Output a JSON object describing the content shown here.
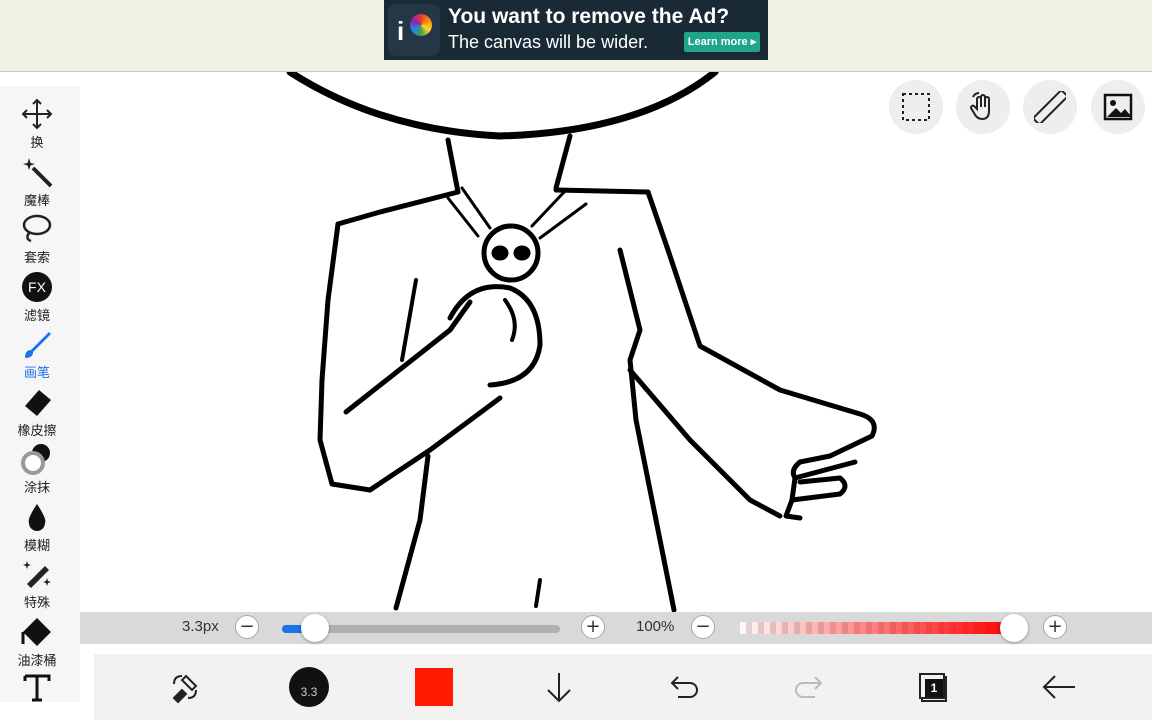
{
  "ad": {
    "title": "You want to remove the Ad?",
    "subtitle": "The canvas will be wider.",
    "cta": "Learn more ▸"
  },
  "tools": [
    {
      "name": "transform",
      "label": "换",
      "icon": "move-arrows-icon"
    },
    {
      "name": "magic-wand",
      "label": "魔棒",
      "icon": "magic-wand-icon"
    },
    {
      "name": "lasso",
      "label": "套索",
      "icon": "lasso-icon"
    },
    {
      "name": "filter",
      "label": "滤镜",
      "icon": "fx-icon",
      "icon_text": "FX"
    },
    {
      "name": "brush",
      "label": "画笔",
      "icon": "brush-icon",
      "active": true
    },
    {
      "name": "eraser",
      "label": "橡皮擦",
      "icon": "eraser-icon"
    },
    {
      "name": "smudge",
      "label": "涂抹",
      "icon": "smudge-icon"
    },
    {
      "name": "blur",
      "label": "模糊",
      "icon": "blur-drop-icon"
    },
    {
      "name": "special",
      "label": "特殊",
      "icon": "sparkle-pen-icon"
    },
    {
      "name": "fill",
      "label": "油漆桶",
      "icon": "paint-bucket-icon"
    },
    {
      "name": "text",
      "label": "",
      "icon": "text-icon",
      "icon_text": "T"
    }
  ],
  "top_right": [
    "selection-icon",
    "hand-gesture-icon",
    "ruler-icon",
    "image-icon"
  ],
  "sliders": {
    "size_label": "3.3px",
    "size_fraction": 0.12,
    "opacity_label": "100%",
    "opacity_fraction": 1.0,
    "minus": "−",
    "plus": "+"
  },
  "bottom": {
    "brush_size": "3.3",
    "color": "#ff1a00",
    "layer_count": "1"
  },
  "colors": {
    "accent": "#1a73e8",
    "ad_bg": "#1a2a35",
    "ad_cta": "#1fa58a"
  }
}
